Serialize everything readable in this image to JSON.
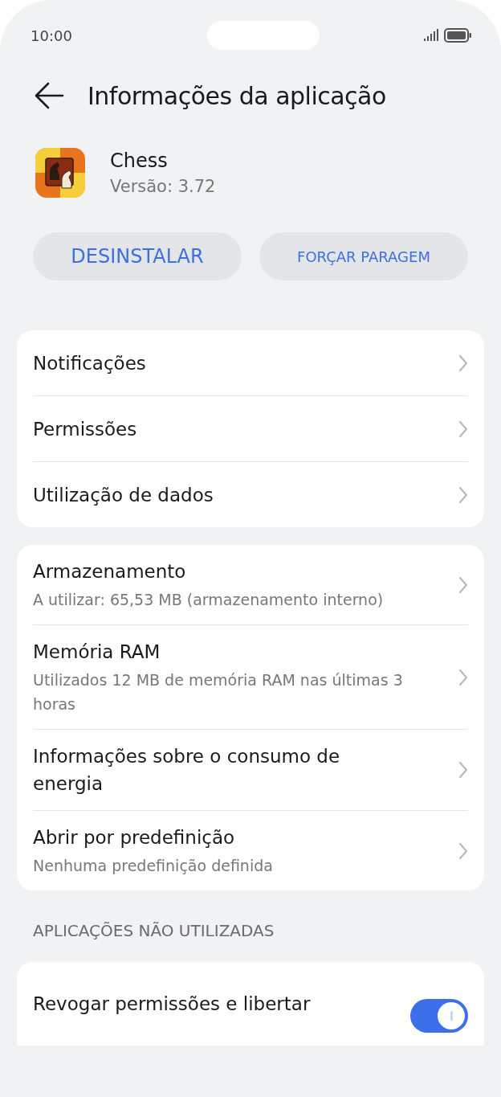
{
  "status_bar": {
    "time": "10:00"
  },
  "header": {
    "title": "Informações da aplicação"
  },
  "app": {
    "name": "Chess",
    "version": "Versão: 3.72"
  },
  "buttons": [
    {
      "label": "DESINSTALAR",
      "kind": "large"
    },
    {
      "label": "FORÇAR PARAGEM",
      "kind": "small"
    }
  ],
  "groups": [
    {
      "items": [
        {
          "title": "Notificações"
        },
        {
          "title": "Permissões"
        },
        {
          "title": "Utilização de dados"
        }
      ]
    },
    {
      "items": [
        {
          "title": "Armazenamento",
          "subtitle": "A utilizar: 65,53 MB (armazenamento interno)"
        },
        {
          "title": "Memória RAM",
          "subtitle": "Utilizados 12 MB de memória RAM nas últimas 3 horas"
        },
        {
          "title": "Informações sobre o consumo de energia"
        },
        {
          "title": "Abrir por predefinição",
          "subtitle": "Nenhuma predefinição definida"
        }
      ]
    }
  ],
  "unused_section": {
    "header": "APLICAÇÕES NÃO UTILIZADAS",
    "items": [
      {
        "title": "Revogar permissões e libertar",
        "on": true
      }
    ]
  }
}
